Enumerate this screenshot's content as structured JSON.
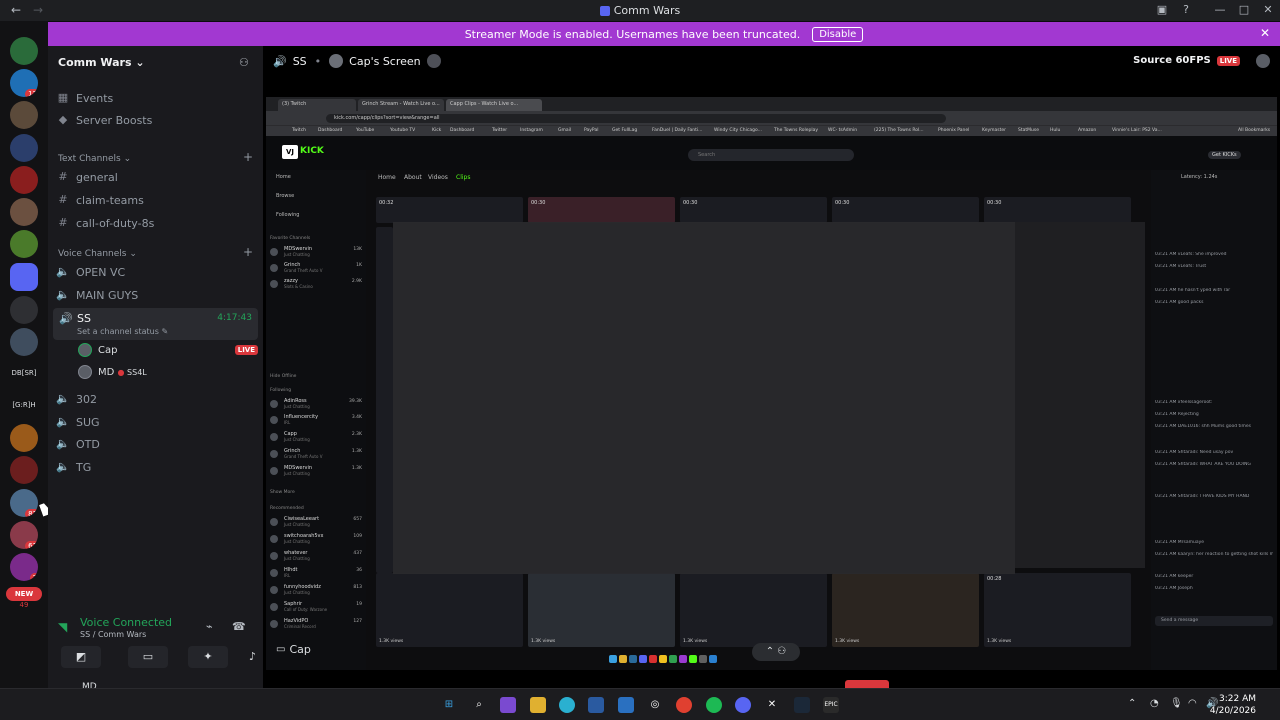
{
  "window": {
    "title": "Comm Wars",
    "back_icon": "←",
    "fwd_icon": "→"
  },
  "streamer_banner": {
    "text": "Streamer Mode is enabled. Usernames have been truncated.",
    "disable_label": "Disable"
  },
  "guilds": {
    "badges": [
      "12",
      "81",
      "61",
      "7",
      "49"
    ],
    "text_icons": [
      "DB[SR]",
      "[G:R]H"
    ],
    "new_label": "NEW"
  },
  "server": {
    "name": "Comm Wars"
  },
  "sidebar": {
    "top_items": [
      {
        "label": "Events"
      },
      {
        "label": "Server Boosts"
      }
    ],
    "text_category": "Text Channels",
    "text_channels": [
      {
        "label": "general"
      },
      {
        "label": "claim-teams"
      },
      {
        "label": "call-of-duty-8s"
      }
    ],
    "voice_category": "Voice Channels",
    "voice_channels_top": [
      {
        "label": "OPEN VC"
      },
      {
        "label": "MAIN GUYS"
      }
    ],
    "active_channel": {
      "label": "SS",
      "time": "4:17:43",
      "status": "Set a channel status"
    },
    "voice_users": [
      {
        "name": "Cap",
        "badge": "LIVE"
      },
      {
        "name": "MD",
        "extra": "SS4L"
      }
    ],
    "voice_channels_bottom": [
      {
        "label": "302"
      },
      {
        "label": "SUG"
      },
      {
        "label": "OTD"
      },
      {
        "label": "TG"
      }
    ]
  },
  "voice_connected": {
    "title": "Voice Connected",
    "subtitle": "SS / Comm Wars"
  },
  "user_panel": {
    "name": "MD"
  },
  "stage": {
    "channel": "SS",
    "screen_title": "Cap's Screen",
    "source": "Source 60FPS",
    "live": "LIVE",
    "footer_user": "Cap"
  },
  "shared": {
    "tabs": [
      "(3) Twitch",
      "Grinch Stream - Watch Live o...",
      "Capp Clips - Watch Live o..."
    ],
    "url": "kick.com/capp/clips?sort=view&range=all",
    "bookmarks": [
      "Twitch",
      "Dashboard",
      "YouTube",
      "Youtube TV",
      "Kick",
      "Dashboard",
      "Twitter",
      "Instagram",
      "Gmail",
      "PayPal",
      "Get FullLag",
      "FanDuel | Daily Fanti...",
      "Windy City Chicago...",
      "The Towns Roleplay",
      "WC- tsAdmin",
      "(225) The Towns Rol...",
      "Phoenix Panel",
      "Keymaster",
      "StatMuse",
      "Hulu",
      "Amazon",
      "Vinnie's Lair: PS2 Va...",
      "All Bookmarks"
    ],
    "search_placeholder": "Search",
    "kick_logo": "KICK",
    "get_kicks": "Get KICKs",
    "side_nav": [
      "Home",
      "Browse",
      "Following"
    ],
    "favorite_header": "Favorite Channels",
    "following_header": "Following",
    "recommended_header": "Recommended",
    "hide_offline": "Hide Offline",
    "show_more": "Show More",
    "favorites": [
      {
        "name": "MDSwervin",
        "cat": "Just Chatting",
        "v": "13K"
      },
      {
        "name": "Grinch",
        "cat": "Grand Theft Auto V",
        "v": "1K"
      },
      {
        "name": "zazzy",
        "cat": "Slots & Casino",
        "v": "2.9K"
      }
    ],
    "following": [
      {
        "name": "AdinRoss",
        "cat": "Just Chatting",
        "v": "39.3K"
      },
      {
        "name": "Influencercity",
        "cat": "IRL",
        "v": "3.4K"
      },
      {
        "name": "Capp",
        "cat": "Just Chatting",
        "v": "2.3K"
      },
      {
        "name": "Grinch",
        "cat": "Grand Theft Auto V",
        "v": "1.3K"
      },
      {
        "name": "MDSwervin",
        "cat": "Just Chatting",
        "v": "1.3K"
      }
    ],
    "recommended": [
      {
        "name": "CiwiseaLeeart",
        "cat": "Just Chatting",
        "v": "657"
      },
      {
        "name": "switchoarah5vx",
        "cat": "Just Chatting",
        "v": "109"
      },
      {
        "name": "whatever",
        "cat": "Just Chatting",
        "v": "437"
      },
      {
        "name": "Hlhdt",
        "cat": "IRL",
        "v": "36"
      },
      {
        "name": "funnyhoodvidz",
        "cat": "Just Chatting",
        "v": "813"
      },
      {
        "name": "Saphrir",
        "cat": "Call of Duty: Warzone",
        "v": "19"
      },
      {
        "name": "HazVidPO",
        "cat": "Criminal Record",
        "v": "127"
      }
    ],
    "tabs_nav": [
      "Home",
      "About",
      "Videos",
      "Clips"
    ],
    "durations": [
      "00:32",
      "00:30",
      "00:30",
      "00:30",
      "00:30",
      "00:28"
    ],
    "views": [
      "1.3K views",
      "1.3K views",
      "1.3K views",
      "1.3K views",
      "1.3K views"
    ],
    "chat_header": "Latency: 1.24s",
    "chat_lines": [
      "03:21 AM vLeafs: She improved",
      "03:21 AM vLeafs: Trust",
      "03:21 AM he hasn't yped with rar",
      "03:21 AM good packs",
      "03:21 AM xfeelssageroot:",
      "03:21 AM Rejecting",
      "03:21 AM DAE1016: shh Mums good times",
      "03:21 AM Shtaradi: Need usay pov",
      "03:21 AM Shtaradi: WHAT ARE YOU DOING",
      "03:21 AM Shtaradi: I HAVE KIDS MY HAND",
      "03:21 AM Mrsamuaye",
      "03:21 AM kaaryn: her reaction to getting shot kills me",
      "03:21 AM keeper",
      "03:21 AM Joseph"
    ],
    "chat_placeholder": "Send a message"
  },
  "taskbar": {
    "time": "3:22 AM",
    "date": "4/20/2026"
  }
}
